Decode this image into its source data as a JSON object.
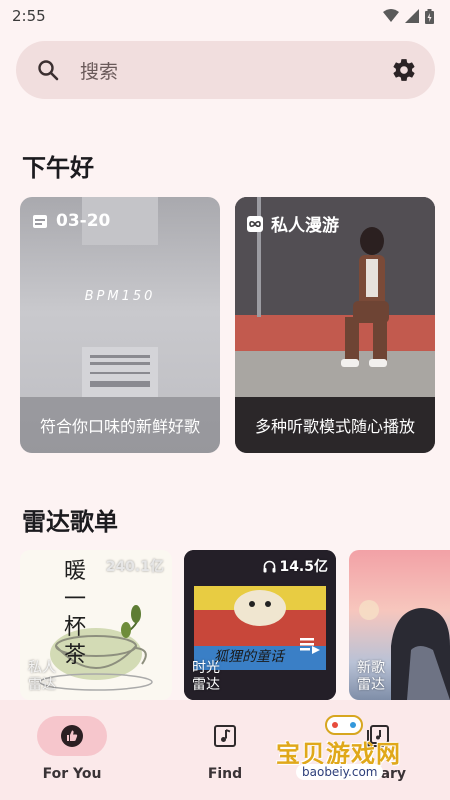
{
  "status_bar": {
    "time": "2:55"
  },
  "search": {
    "placeholder": "搜索"
  },
  "greeting": "下午好",
  "cards": [
    {
      "icon": "calendar-icon",
      "header": "03-20",
      "caption": "符合你口味的新鲜好歌",
      "art_text": "BPM150"
    },
    {
      "icon": "infinity-icon",
      "header": "私人漫游",
      "caption": "多种听歌模式随心播放"
    }
  ],
  "radar_title": "雷达歌单",
  "playlists": [
    {
      "count": "240.1亿",
      "label_line1": "私人",
      "label_line2": "雷达",
      "art_text": "暖一杯茶"
    },
    {
      "count": "14.5亿",
      "label_line1": "时光",
      "label_line2": "雷达",
      "art_text": "狐狸的童话"
    },
    {
      "count": "",
      "label_line1": "新歌",
      "label_line2": "雷达"
    }
  ],
  "nav": [
    {
      "label": "For You",
      "icon": "thumb-up-icon",
      "active": true
    },
    {
      "label": "Find",
      "icon": "music-note-icon",
      "active": false
    },
    {
      "label": "Library",
      "icon": "library-icon",
      "active": false
    }
  ],
  "watermark": {
    "line1": "宝贝游戏网",
    "line2": "baobeiy.com"
  },
  "colors": {
    "background": "#fdf3f3",
    "search_bg": "#f1dede",
    "nav_active": "#f6c6cc",
    "nav_bg": "#fbe9ea"
  }
}
